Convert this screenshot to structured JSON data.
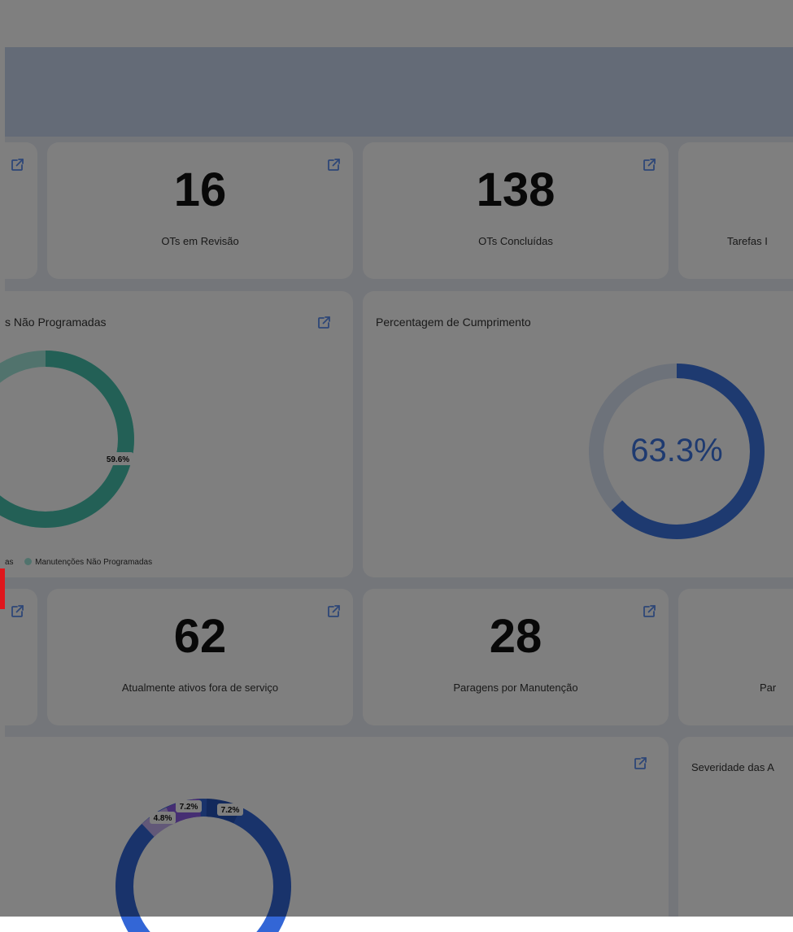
{
  "stats_row1": [
    {
      "value": "16",
      "label": "OTs em Revisão"
    },
    {
      "value": "138",
      "label": "OTs Concluídas"
    },
    {
      "value": "",
      "label": "Tarefas I"
    }
  ],
  "stats_row2": [
    {
      "value": "62",
      "label": "Atualmente ativos fora de serviço"
    },
    {
      "value": "28",
      "label": "Paragens por Manutenção"
    },
    {
      "value": "",
      "label": "Par"
    }
  ],
  "maint_chart": {
    "title": "s Não Programadas",
    "legend_left": "as",
    "legend_item": "Manutenções Não Programadas",
    "chart_data": {
      "type": "pie",
      "slices": [
        {
          "label": "59.6%",
          "value": 59.6,
          "color": "#47c1ad"
        },
        {
          "label": "",
          "value": 40.4,
          "color": "#a3e6da"
        }
      ]
    }
  },
  "compliance": {
    "title": "Percentagem de Cumprimento",
    "value_text": "63.3%",
    "value": 63.3,
    "color": "#3d74e0",
    "track": "#dbe4f5"
  },
  "donut2": {
    "chart_data": {
      "type": "pie",
      "labels": [
        "7.2%",
        "7.2%",
        "4.8%"
      ],
      "colors": {
        "blue": "#3366d6",
        "purple": "#8c5ce6",
        "light_purple": "#c4b0f0"
      }
    }
  },
  "severity": {
    "title": "Severidade das A"
  },
  "colors": {
    "bg": "#e8edf5",
    "banner": "#c9d6ee",
    "accent": "#3d74e0",
    "alert": "#e0161c"
  }
}
